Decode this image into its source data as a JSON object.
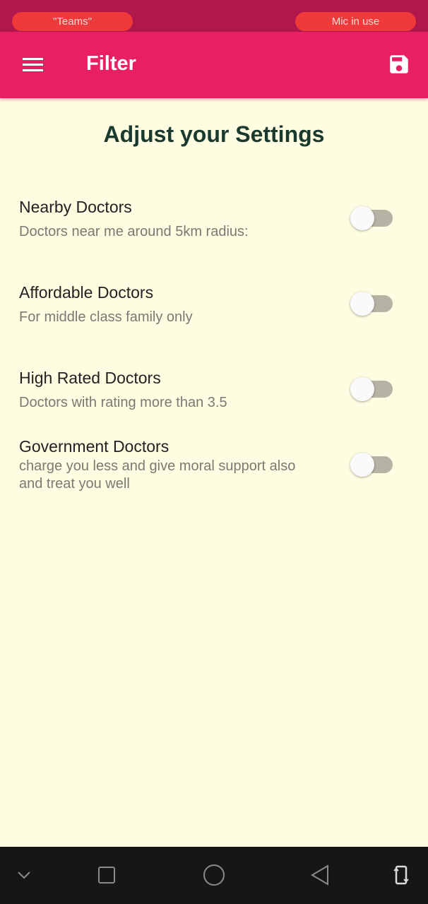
{
  "status_bar": {
    "left_pill": "\"Teams\"",
    "right_pill": "Mic in use"
  },
  "app_bar": {
    "title": "Filter",
    "menu_icon": "hamburger-menu",
    "action_icon": "save-floppy"
  },
  "heading": "Adjust your Settings",
  "settings": [
    {
      "title": "Nearby Doctors",
      "description": "Doctors near me around 5km radius:",
      "enabled": false
    },
    {
      "title": "Affordable Doctors",
      "description": "For middle class family only",
      "enabled": false
    },
    {
      "title": "High Rated Doctors",
      "description": "Doctors with rating more than 3.5",
      "enabled": false
    },
    {
      "title": "Government Doctors",
      "description": "charge you less and give moral support also and treat you well",
      "enabled": false
    }
  ],
  "nav_bar": {
    "icons": [
      "chevron-down",
      "recent-apps-square",
      "home-circle",
      "back-triangle",
      "rotate-screen"
    ]
  },
  "colors": {
    "primary": "#E91E63",
    "status_bar": "#B0174A",
    "background": "#FEFCE1",
    "heading": "#1B3A2F"
  }
}
